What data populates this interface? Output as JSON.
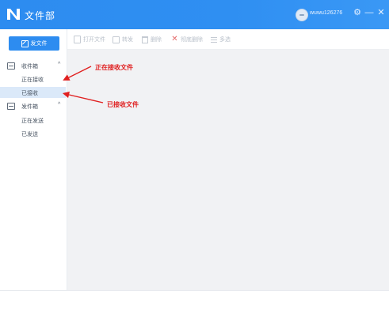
{
  "app": {
    "title": "文件部",
    "username": "wuwu126276"
  },
  "titlebar": {
    "settings_icon": "gear-icon",
    "minimize_icon": "minimize-icon",
    "close_icon": "close-icon"
  },
  "sidebar": {
    "send_label": "发文件",
    "inbox": {
      "label": "收件箱",
      "items": [
        "正在接收",
        "已接收"
      ]
    },
    "outbox": {
      "label": "发件箱",
      "items": [
        "正在发送",
        "已发送"
      ]
    }
  },
  "toolbar": {
    "open": "打开文件",
    "forward": "转发",
    "delete": "删除",
    "delete_all": "彻底删除",
    "multi_select": "多选"
  },
  "annotations": {
    "receiving": "正在接收文件",
    "received": "已接收文件"
  },
  "colors": {
    "accent": "#2d8cf0",
    "annotation": "#e02020",
    "active_row": "#dbe9f9"
  }
}
